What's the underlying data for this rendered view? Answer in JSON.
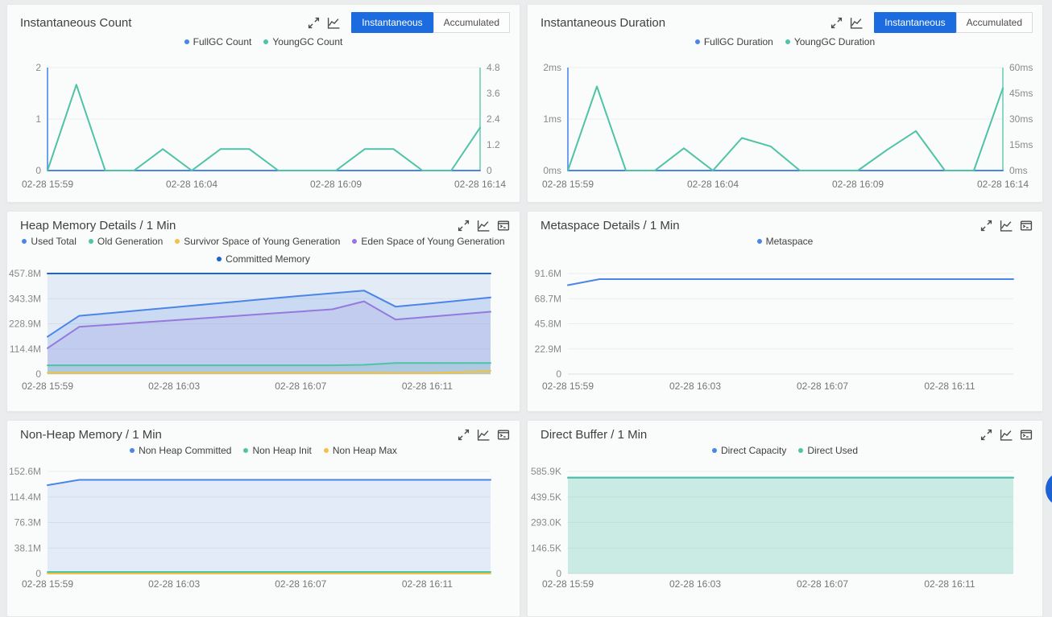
{
  "page": {
    "background": "#ebeced",
    "accent_blue": "#1c6cdf",
    "fab_color": "#1d62d2"
  },
  "palette": {
    "blue": "#4b85e8",
    "teal": "#4fc3a6",
    "dark_blue": "#1c64d1",
    "purple": "#9579dd",
    "yellow": "#f2c242"
  },
  "panels": [
    {
      "title": "Instantaneous Count",
      "icons": [
        "expand-icon",
        "line-chart-icon"
      ],
      "buttons": [
        {
          "label": "Instantaneous",
          "active": true
        },
        {
          "label": "Accumulated",
          "active": false
        }
      ],
      "legend_rows": [
        [
          {
            "label": "FullGC Count",
            "color": "#4b85e8"
          },
          {
            "label": "YoungGC Count",
            "color": "#4fc3a6"
          }
        ]
      ],
      "y_axis": {
        "labels": [
          "2",
          "1",
          "0"
        ],
        "max": 2,
        "axis_color": "#6f9ef2"
      },
      "y_axis_right": {
        "labels": [
          "4.8",
          "3.6",
          "2.4",
          "1.2",
          "0"
        ],
        "max": 4.8,
        "axis_color": "#8ad8c4"
      },
      "x_labels": [
        "02-28 15:59",
        "02-28 16:04",
        "02-28 16:09",
        "02-28 16:14"
      ],
      "x_label_fracs": [
        0,
        0.3333,
        0.6667,
        1
      ],
      "chart_data": {
        "type": "line",
        "xlabel_note": "one point per minute 15:59-16:14",
        "series": [
          {
            "name": "FullGC Count",
            "color": "#4b85e8",
            "axis": "left",
            "fill_opacity": 0,
            "values": [
              0,
              0,
              0,
              0,
              0,
              0,
              0,
              0,
              0,
              0,
              0,
              0,
              0,
              0,
              0,
              0
            ]
          },
          {
            "name": "YoungGC Count",
            "color": "#4fc3a6",
            "axis": "right",
            "fill_opacity": 0,
            "values": [
              0,
              4,
              0,
              0,
              1,
              0,
              1,
              1,
              0,
              0,
              0,
              1,
              1,
              0,
              0,
              2
            ]
          }
        ]
      }
    },
    {
      "title": "Instantaneous Duration",
      "icons": [
        "expand-icon",
        "line-chart-icon"
      ],
      "buttons": [
        {
          "label": "Instantaneous",
          "active": true
        },
        {
          "label": "Accumulated",
          "active": false
        }
      ],
      "legend_rows": [
        [
          {
            "label": "FullGC Duration",
            "color": "#4b85e8"
          },
          {
            "label": "YoungGC Duration",
            "color": "#4fc3a6"
          }
        ]
      ],
      "y_axis": {
        "labels": [
          "2ms",
          "1ms",
          "0ms"
        ],
        "max": 2,
        "axis_color": "#6f9ef2"
      },
      "y_axis_right": {
        "labels": [
          "60ms",
          "45ms",
          "30ms",
          "15ms",
          "0ms"
        ],
        "max": 60,
        "axis_color": "#8ad8c4"
      },
      "x_labels": [
        "02-28 15:59",
        "02-28 16:04",
        "02-28 16:09",
        "02-28 16:14"
      ],
      "x_label_fracs": [
        0,
        0.3333,
        0.6667,
        1
      ],
      "chart_data": {
        "type": "line",
        "series": [
          {
            "name": "FullGC Duration",
            "color": "#4b85e8",
            "axis": "left",
            "fill_opacity": 0,
            "values": [
              0,
              0,
              0,
              0,
              0,
              0,
              0,
              0,
              0,
              0,
              0,
              0,
              0,
              0,
              0,
              0
            ]
          },
          {
            "name": "YoungGC Duration",
            "color": "#4fc3a6",
            "axis": "right",
            "fill_opacity": 0,
            "values": [
              0,
              49,
              0,
              0,
              13,
              0,
              19,
              14,
              0,
              0,
              0,
              12,
              23,
              0,
              0,
              48
            ]
          }
        ]
      }
    },
    {
      "title": "Heap Memory Details / 1 Min",
      "icons": [
        "expand-icon",
        "line-chart-icon",
        "console-icon"
      ],
      "buttons": [],
      "legend_rows": [
        [
          {
            "label": "Used Total",
            "color": "#4b85e8"
          },
          {
            "label": "Old Generation",
            "color": "#4fc3a6"
          },
          {
            "label": "Survivor Space of Young Generation",
            "color": "#f2c242"
          },
          {
            "label": "Eden Space of Young Generation",
            "color": "#9579dd"
          }
        ],
        [
          {
            "label": "Committed Memory",
            "color": "#1c64d1"
          }
        ]
      ],
      "y_axis": {
        "labels": [
          "457.8M",
          "343.3M",
          "228.9M",
          "114.4M",
          "0"
        ],
        "max": 457.8,
        "axis_color": null
      },
      "y_axis_right": null,
      "x_labels": [
        "02-28 15:59",
        "02-28 16:03",
        "02-28 16:07",
        "02-28 16:11"
      ],
      "x_label_fracs": [
        0,
        0.2857,
        0.5714,
        0.8571
      ],
      "chart_data": {
        "type": "area",
        "unit": "MB",
        "series": [
          {
            "name": "Committed Memory",
            "color": "#1c64d1",
            "axis": "left",
            "fill_opacity": 0.1,
            "values": [
              457.8,
              457.8,
              457.8,
              457.8,
              457.8,
              457.8,
              457.8,
              457.8,
              457.8,
              457.8,
              457.8,
              457.8,
              457.8,
              457.8,
              457.8
            ]
          },
          {
            "name": "Used Total",
            "color": "#4b85e8",
            "axis": "left",
            "fill_opacity": 0.16,
            "values": [
              170,
              265,
              278,
              291,
              304,
              317,
              330,
              343,
              356,
              368,
              380,
              307,
              320,
              334,
              349
            ]
          },
          {
            "name": "Eden Space of Young Generation",
            "color": "#9579dd",
            "axis": "left",
            "fill_opacity": 0.14,
            "values": [
              118,
              215,
              225,
              235,
              245,
              255,
              265,
              275,
              285,
              295,
              331,
              248,
              260,
              272,
              284
            ]
          },
          {
            "name": "Old Generation",
            "color": "#4fc3a6",
            "axis": "left",
            "fill_opacity": 0.18,
            "values": [
              40,
              40,
              40,
              40,
              40,
              40,
              40,
              40,
              40,
              40,
              42,
              50,
              50,
              50,
              50
            ]
          },
          {
            "name": "Survivor Space of Young Generation",
            "color": "#f2c242",
            "axis": "left",
            "fill_opacity": 0.3,
            "values": [
              6,
              6,
              6,
              6,
              6,
              6,
              6,
              6,
              6,
              6,
              6,
              5,
              5,
              8,
              15
            ]
          }
        ]
      }
    },
    {
      "title": "Metaspace Details / 1 Min",
      "icons": [
        "expand-icon",
        "line-chart-icon",
        "console-icon"
      ],
      "buttons": [],
      "legend_rows": [
        [
          {
            "label": "Metaspace",
            "color": "#4b85e8"
          }
        ]
      ],
      "y_axis": {
        "labels": [
          "91.6M",
          "68.7M",
          "45.8M",
          "22.9M",
          "0"
        ],
        "max": 91.6,
        "axis_color": null
      },
      "y_axis_right": null,
      "x_labels": [
        "02-28 15:59",
        "02-28 16:03",
        "02-28 16:07",
        "02-28 16:11"
      ],
      "x_label_fracs": [
        0,
        0.2857,
        0.5714,
        0.8571
      ],
      "chart_data": {
        "type": "line",
        "unit": "MB",
        "series": [
          {
            "name": "Metaspace",
            "color": "#4b85e8",
            "axis": "left",
            "fill_opacity": 0,
            "values": [
              81,
              86.5,
              86.5,
              86.5,
              86.5,
              86.5,
              86.5,
              86.5,
              86.5,
              86.5,
              86.5,
              86.5,
              86.5,
              86.5,
              86.5
            ]
          }
        ]
      }
    },
    {
      "title": "Non-Heap Memory / 1 Min",
      "icons": [
        "expand-icon",
        "line-chart-icon",
        "console-icon"
      ],
      "buttons": [],
      "legend_rows": [
        [
          {
            "label": "Non Heap Committed",
            "color": "#4b85e8"
          },
          {
            "label": "Non Heap Init",
            "color": "#4fc3a6"
          },
          {
            "label": "Non Heap Max",
            "color": "#f2c242"
          }
        ]
      ],
      "y_axis": {
        "labels": [
          "152.6M",
          "114.4M",
          "76.3M",
          "38.1M",
          "0"
        ],
        "max": 152.6,
        "axis_color": null
      },
      "y_axis_right": null,
      "x_labels": [
        "02-28 15:59",
        "02-28 16:03",
        "02-28 16:07",
        "02-28 16:11"
      ],
      "x_label_fracs": [
        0,
        0.2857,
        0.5714,
        0.8571
      ],
      "chart_data": {
        "type": "area",
        "unit": "MB",
        "series": [
          {
            "name": "Non Heap Committed",
            "color": "#4b85e8",
            "axis": "left",
            "fill_opacity": 0.13,
            "values": [
              132,
              140,
              140,
              140,
              140,
              140,
              140,
              140,
              140,
              140,
              140,
              140,
              140,
              140,
              140
            ]
          },
          {
            "name": "Non Heap Init",
            "color": "#4fc3a6",
            "axis": "left",
            "fill_opacity": 0.25,
            "values": [
              2.4,
              2.4,
              2.4,
              2.4,
              2.4,
              2.4,
              2.4,
              2.4,
              2.4,
              2.4,
              2.4,
              2.4,
              2.4,
              2.4,
              2.4
            ]
          },
          {
            "name": "Non Heap Max",
            "color": "#f2c242",
            "axis": "left",
            "fill_opacity": 0,
            "values": [
              0,
              0,
              0,
              0,
              0,
              0,
              0,
              0,
              0,
              0,
              0,
              0,
              0,
              0,
              0
            ]
          }
        ]
      }
    },
    {
      "title": "Direct Buffer / 1 Min",
      "icons": [
        "expand-icon",
        "line-chart-icon",
        "console-icon"
      ],
      "buttons": [],
      "legend_rows": [
        [
          {
            "label": "Direct Capacity",
            "color": "#4b85e8"
          },
          {
            "label": "Direct Used",
            "color": "#4fc3a6"
          }
        ]
      ],
      "y_axis": {
        "labels": [
          "585.9K",
          "439.5K",
          "293.0K",
          "146.5K",
          "0"
        ],
        "max": 585.9,
        "axis_color": null
      },
      "y_axis_right": null,
      "x_labels": [
        "02-28 15:59",
        "02-28 16:03",
        "02-28 16:07",
        "02-28 16:11"
      ],
      "x_label_fracs": [
        0,
        0.2857,
        0.5714,
        0.8571
      ],
      "chart_data": {
        "type": "area",
        "unit": "KB",
        "series": [
          {
            "name": "Direct Capacity",
            "color": "#4b85e8",
            "axis": "left",
            "fill_opacity": 0,
            "values": [
              550,
              550,
              550,
              550,
              550,
              550,
              550,
              550,
              550,
              550,
              550,
              550,
              550,
              550,
              550
            ]
          },
          {
            "name": "Direct Used",
            "color": "#4fc3a6",
            "axis": "left",
            "fill_opacity": 0.28,
            "values": [
              550,
              550,
              550,
              550,
              550,
              550,
              550,
              550,
              550,
              550,
              550,
              550,
              550,
              550,
              550
            ]
          }
        ]
      }
    }
  ]
}
